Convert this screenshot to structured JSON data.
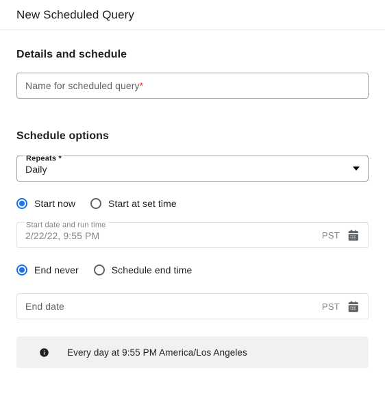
{
  "dialog": {
    "title": "New Scheduled Query"
  },
  "details_section": {
    "heading": "Details and schedule",
    "name_field": {
      "placeholder": "Name for scheduled query",
      "required_marker": "*",
      "value": ""
    }
  },
  "schedule_section": {
    "heading": "Schedule options",
    "repeats_field": {
      "label": "Repeats *",
      "selected": "Daily",
      "icon": "chevron-down-icon"
    },
    "start_radio_group": {
      "options": [
        {
          "label": "Start now",
          "selected": true
        },
        {
          "label": "Start at set time",
          "selected": false
        }
      ]
    },
    "start_date_field": {
      "label": "Start date and run time",
      "value": "2/22/22, 9:55 PM",
      "timezone": "PST",
      "icon": "calendar-icon",
      "disabled": true
    },
    "end_radio_group": {
      "options": [
        {
          "label": "End never",
          "selected": true
        },
        {
          "label": "Schedule end time",
          "selected": false
        }
      ]
    },
    "end_date_field": {
      "placeholder": "End date",
      "value": "",
      "timezone": "PST",
      "icon": "calendar-icon",
      "disabled": true
    }
  },
  "info_banner": {
    "icon": "info-icon",
    "text": "Every day at 9:55 PM America/Los Angeles"
  },
  "colors": {
    "accent": "#1a73e8",
    "required": "#d93025",
    "banner_bg": "#f1f1f2",
    "border": "#9aa0a6",
    "border_disabled": "#e0e0e0",
    "text_primary": "#202124",
    "text_secondary": "#5f6368",
    "text_disabled": "#80868b"
  }
}
